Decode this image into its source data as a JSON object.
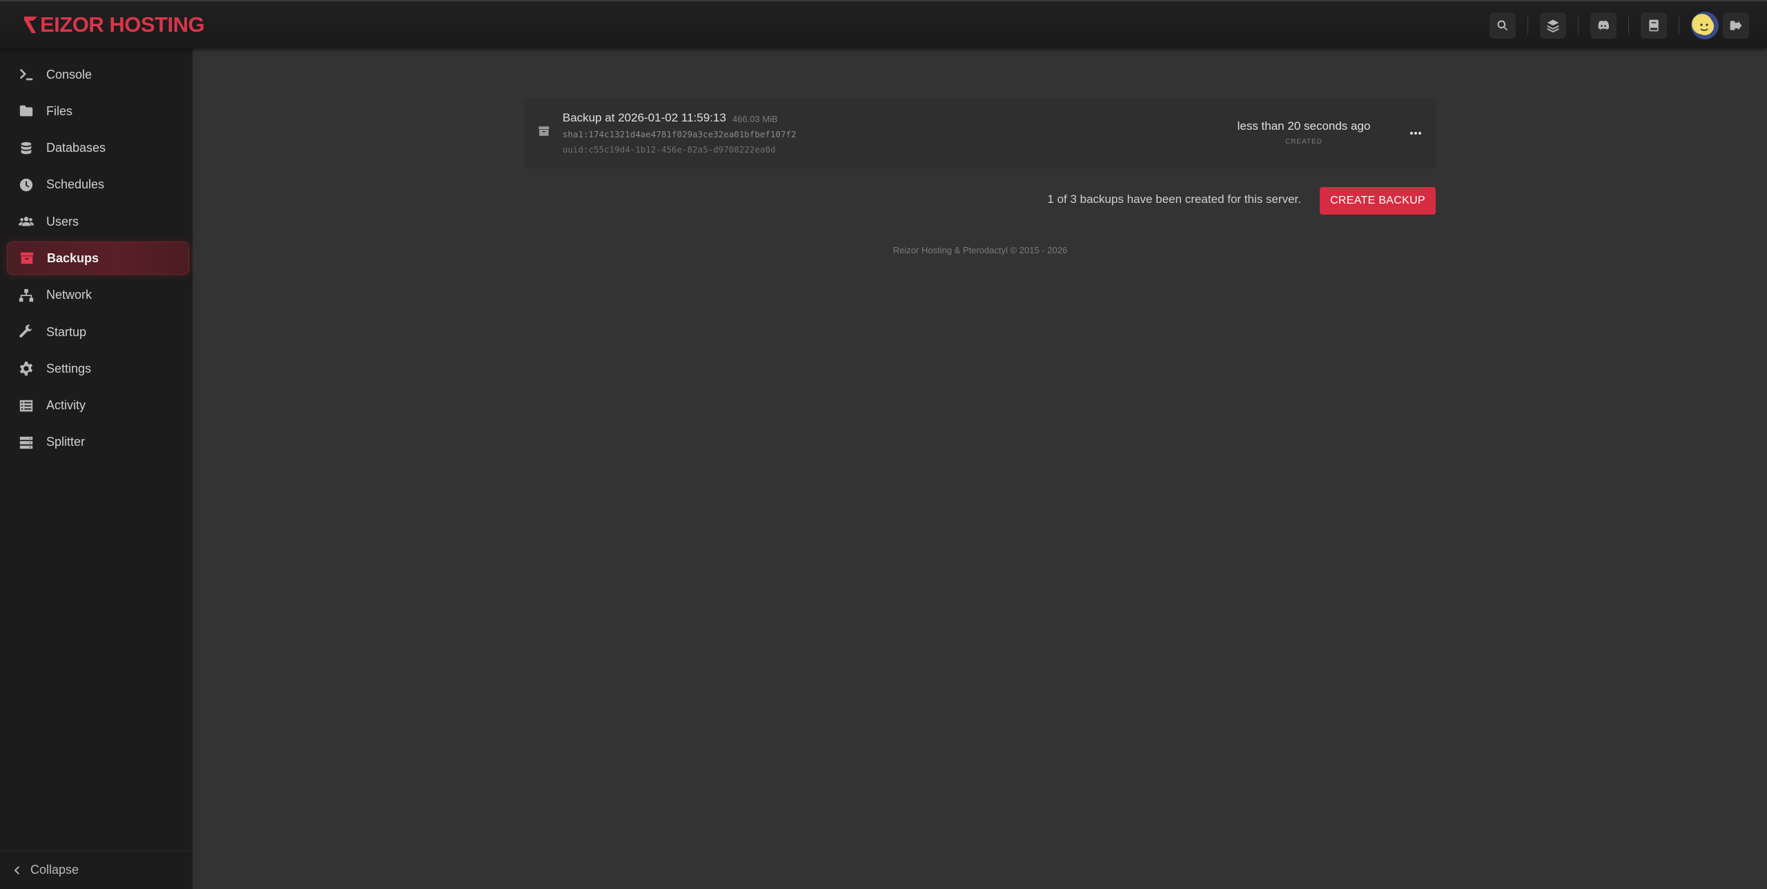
{
  "brand": {
    "logo_text": "EIZOR HOSTING",
    "accent": "#d62c41"
  },
  "header": {
    "icons": [
      "search-icon",
      "layers-icon",
      "discord-icon",
      "book-icon",
      "avatar",
      "logout-icon"
    ]
  },
  "sidebar": {
    "items": [
      {
        "label": "Console",
        "icon": "terminal-icon"
      },
      {
        "label": "Files",
        "icon": "folder-icon"
      },
      {
        "label": "Databases",
        "icon": "database-icon"
      },
      {
        "label": "Schedules",
        "icon": "clock-icon"
      },
      {
        "label": "Users",
        "icon": "users-icon"
      },
      {
        "label": "Backups",
        "icon": "archive-icon",
        "active": true
      },
      {
        "label": "Network",
        "icon": "network-icon"
      },
      {
        "label": "Startup",
        "icon": "wrench-icon"
      },
      {
        "label": "Settings",
        "icon": "gear-icon"
      },
      {
        "label": "Activity",
        "icon": "list-icon"
      },
      {
        "label": "Splitter",
        "icon": "server-icon"
      }
    ],
    "collapse_label": "Collapse"
  },
  "backup": {
    "name": "Backup at 2026-01-02 11:59:13",
    "size": "466.03 MiB",
    "sha": "sha1:174c1321d4ae4781f029a3ce32ea01bfbef107f2",
    "uuid": "uuid:c55c19d4-1b12-456e-82a5-d9708222ea0d",
    "time": "less than 20 seconds ago",
    "status": "CREATED"
  },
  "quota_text": "1 of 3 backups have been created for this server.",
  "create_button_label": "CREATE BACKUP",
  "footer_text": "Reizor Hosting & Pterodactyl © 2015 - 2026"
}
